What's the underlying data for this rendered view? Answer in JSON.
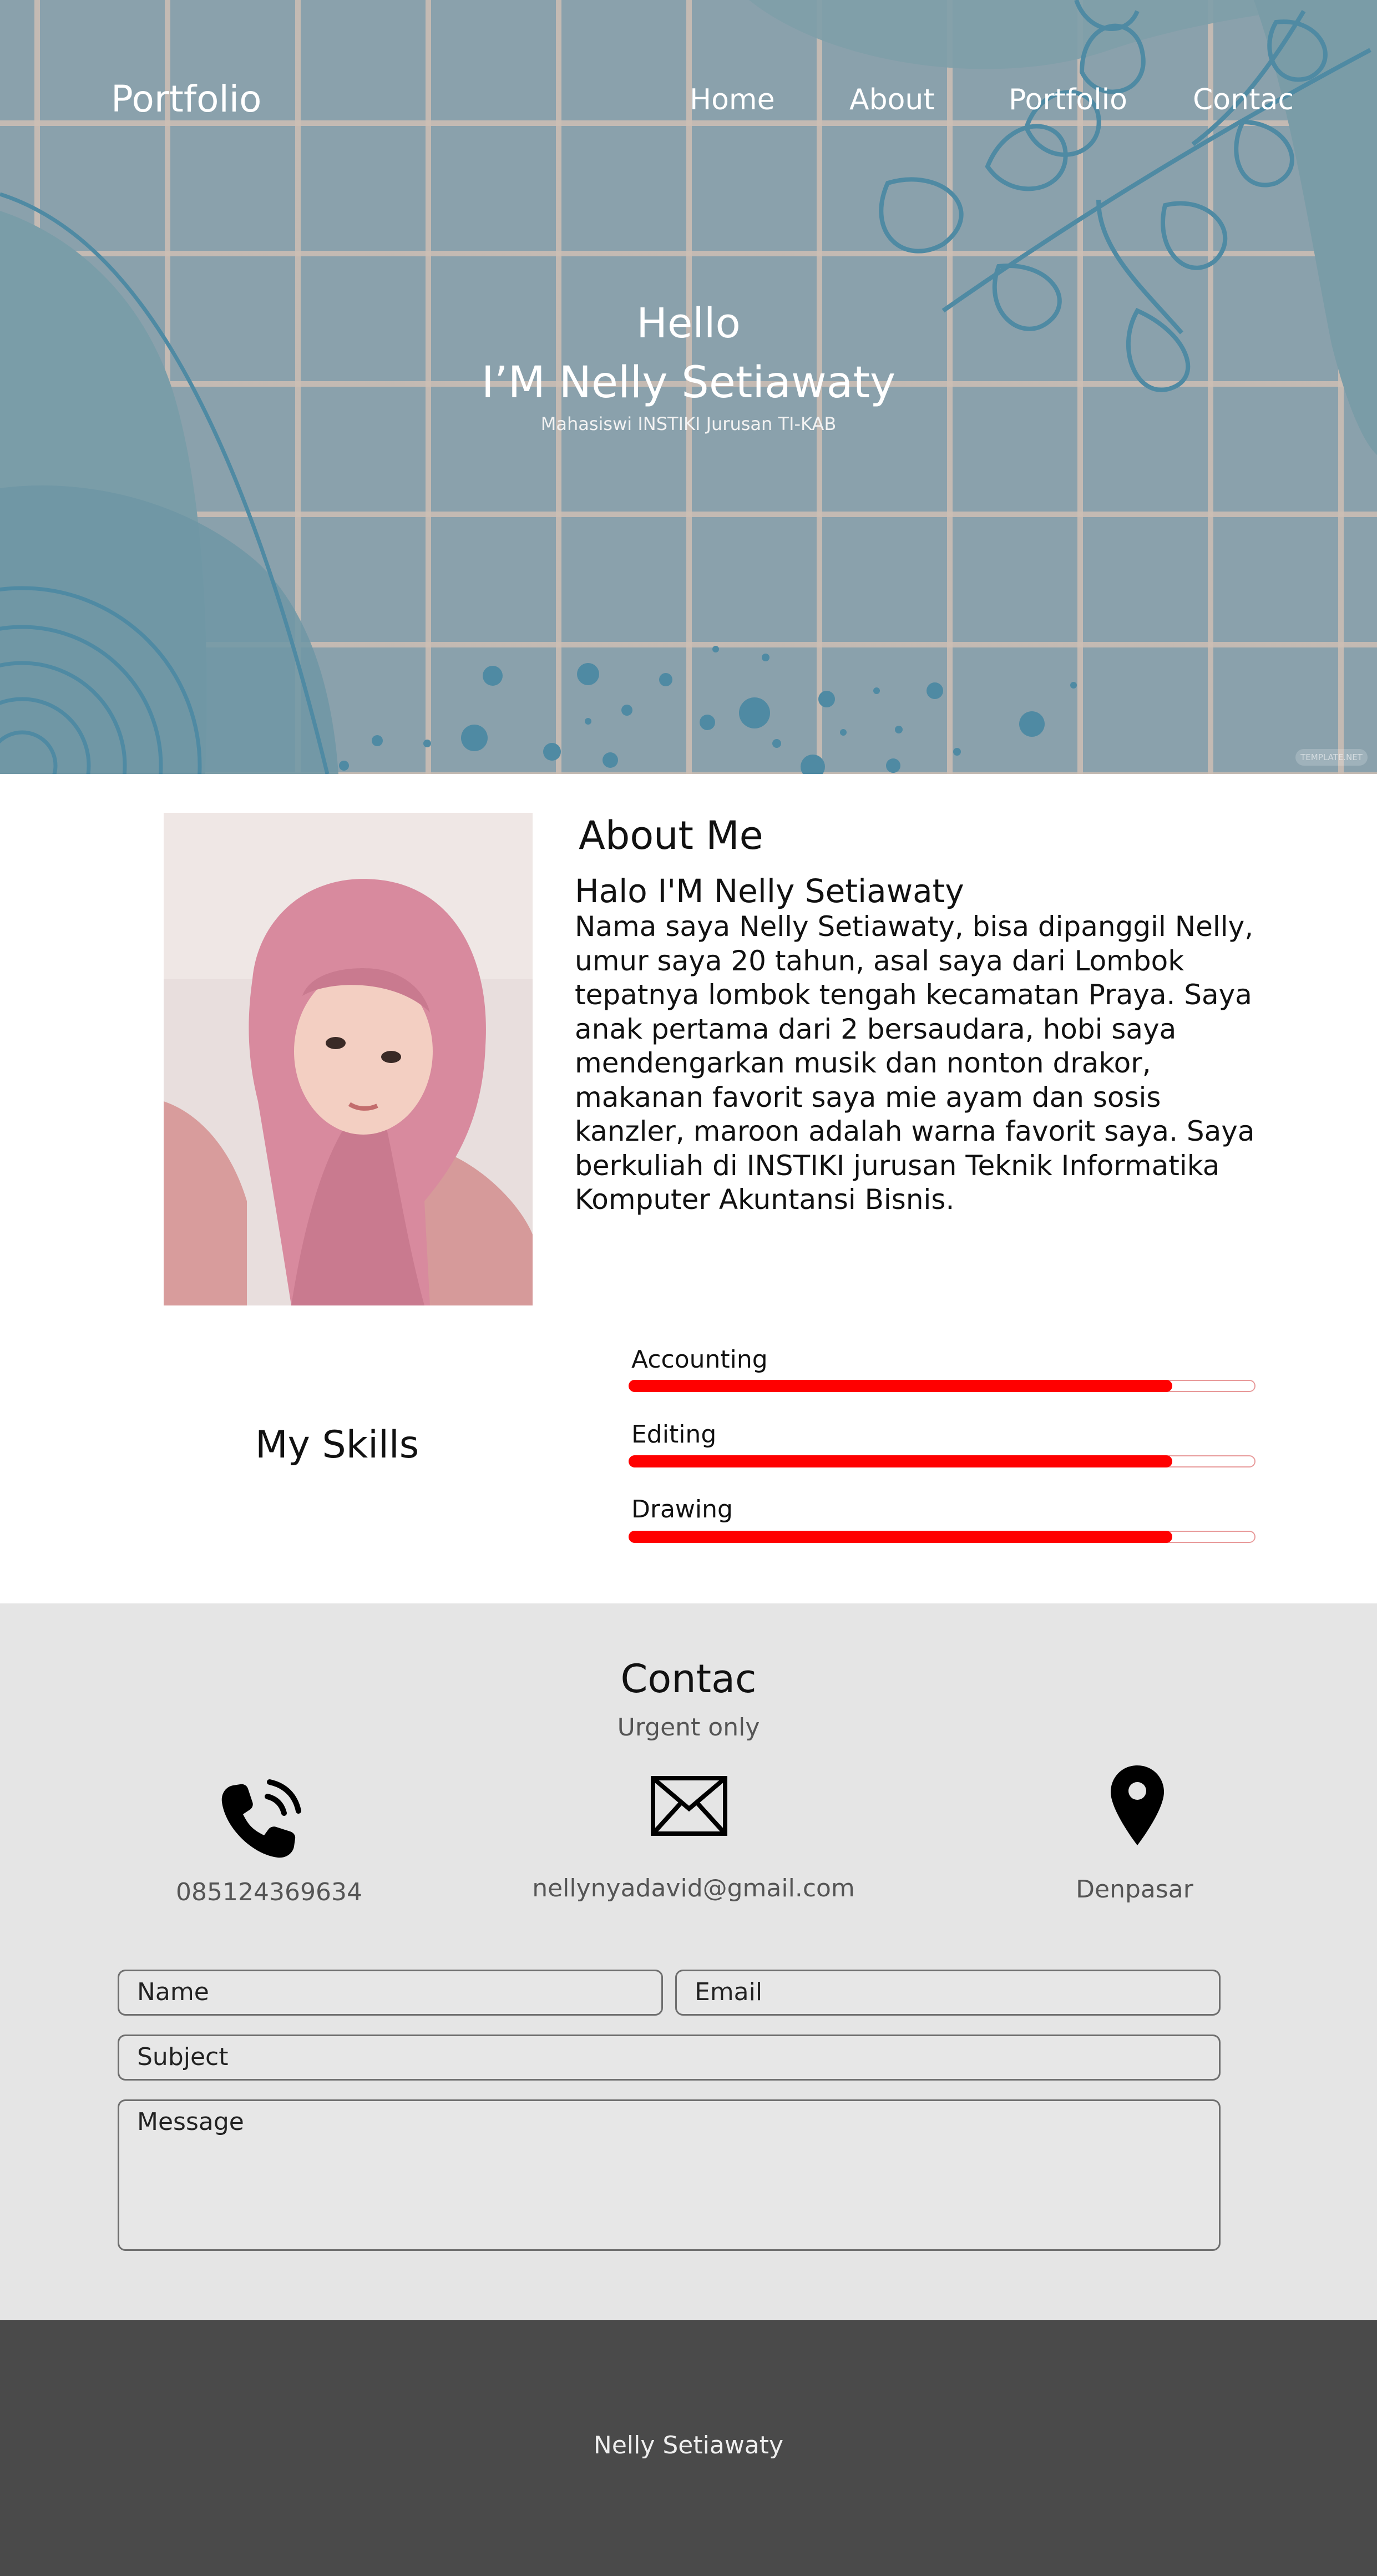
{
  "header": {
    "brand": "Portfolio",
    "nav": [
      "Home",
      "About",
      "Portfolio",
      "Contac"
    ]
  },
  "hero": {
    "greeting": "Hello",
    "name": "I’M Nelly Setiawaty",
    "subtitle": "Mahasiswi INSTIKI Jurusan TI-KAB",
    "watermark": "TEMPLATE.NET"
  },
  "about": {
    "title": "About Me",
    "heading": "Halo I'M Nelly Setiawaty",
    "text": "Nama saya Nelly Setiawaty, bisa dipanggil Nelly, umur saya 20 tahun, asal saya dari Lombok tepatnya lombok tengah kecamatan Praya. Saya anak pertama dari 2 bersaudara, hobi saya mendengarkan musik dan nonton drakor, makanan favorit saya mie ayam dan sosis kanzler, maroon adalah warna favorit saya. Saya berkuliah di INSTIKI jurusan Teknik Informatika Komputer Akuntansi Bisnis."
  },
  "skills": {
    "title": "My Skills",
    "items": [
      {
        "label": "Accounting",
        "level": 0.87
      },
      {
        "label": "Editing",
        "level": 0.87
      },
      {
        "label": "Drawing",
        "level": 0.87
      }
    ],
    "bar_color": "#ff0000"
  },
  "contact": {
    "title": "Contac",
    "subtitle": "Urgent only",
    "phone": "085124369634",
    "email": "nellynyadavid@gmail.com",
    "location": "Denpasar",
    "icons": [
      "phone-icon",
      "mail-icon",
      "location-pin-icon"
    ],
    "form": {
      "name": "Name",
      "email": "Email",
      "subject": "Subject",
      "message": "Message"
    }
  },
  "footer": {
    "text": "Nelly Setiawaty"
  },
  "colors": {
    "hero_bg": "#8aa1ac",
    "contact_bg": "#e5e5e5",
    "footer_bg": "#4a4a4a",
    "accent": "#ff0000"
  }
}
